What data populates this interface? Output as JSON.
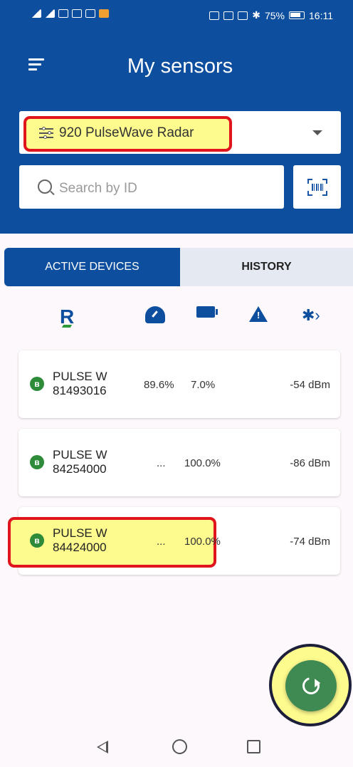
{
  "status_bar": {
    "battery": "75%",
    "time": "16:11"
  },
  "header": {
    "title": "My sensors"
  },
  "sensor_selector": {
    "value": "920 PulseWave Radar"
  },
  "search": {
    "placeholder": "Search by ID"
  },
  "tabs": [
    {
      "label": "ACTIVE DEVICES",
      "active": true
    },
    {
      "label": "HISTORY",
      "active": false
    }
  ],
  "columns": [
    "r-logo-icon",
    "gauge-icon",
    "battery-icon",
    "warning-icon",
    "bluetooth-signal-icon"
  ],
  "devices": [
    {
      "name": "PULSE W",
      "id": "81493016",
      "level": "89.6%",
      "battery": "7.0%",
      "signal": "-54 dBm"
    },
    {
      "name": "PULSE W",
      "id": "84254000",
      "level": "...",
      "battery": "100.0%",
      "signal": "-86 dBm"
    },
    {
      "name": "PULSE W",
      "id": "84424000",
      "level": "...",
      "battery": "100.0%",
      "signal": "-74 dBm"
    }
  ],
  "colors": {
    "primary": "#0d4f9e",
    "fab": "#3f8a52",
    "highlight": "#fdfb8e",
    "highlight_border": "#e0141c",
    "bluetooth": "#2e8b3a"
  }
}
